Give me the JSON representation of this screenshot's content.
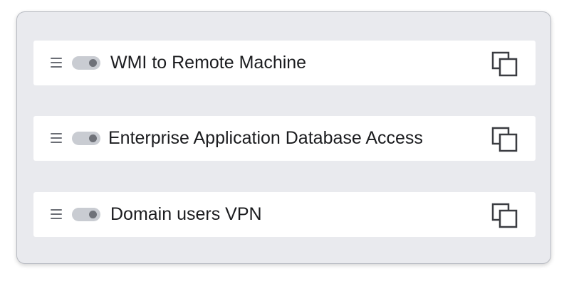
{
  "rules": [
    {
      "name": "WMI to Remote Machine",
      "enabled": true,
      "toggle_icon": "toggle-switch",
      "drag_icon": "drag-handle-icon",
      "action_icon": "copy-icon"
    },
    {
      "name": "Enterprise Application Database Access",
      "enabled": true,
      "toggle_icon": "toggle-switch",
      "drag_icon": "drag-handle-icon",
      "action_icon": "copy-icon"
    },
    {
      "name": "Domain users VPN",
      "enabled": true,
      "toggle_icon": "toggle-switch",
      "drag_icon": "drag-handle-icon",
      "action_icon": "copy-icon"
    }
  ],
  "colors": {
    "panel_background": "#e9eaee",
    "row_background": "#ffffff",
    "text": "#1b1c1f",
    "toggle_track": "#c9ccd2",
    "toggle_knob": "#6f7279",
    "icon": "#3a3c41"
  }
}
